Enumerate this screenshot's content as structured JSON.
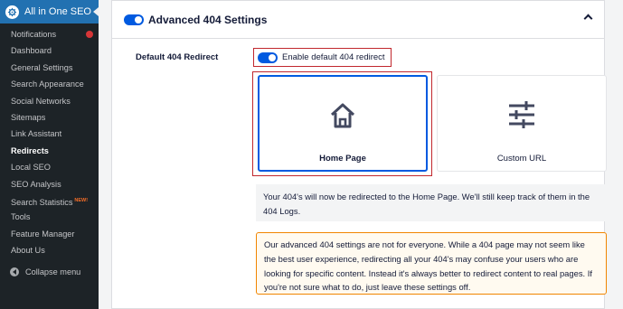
{
  "sidebar": {
    "brand": "All in One SEO",
    "items": [
      {
        "label": "Notifications"
      },
      {
        "label": "Dashboard"
      },
      {
        "label": "General Settings"
      },
      {
        "label": "Search Appearance"
      },
      {
        "label": "Social Networks"
      },
      {
        "label": "Sitemaps"
      },
      {
        "label": "Link Assistant"
      },
      {
        "label": "Redirects"
      },
      {
        "label": "Local SEO"
      },
      {
        "label": "SEO Analysis"
      },
      {
        "label": "Search Statistics",
        "badge": "NEW!"
      },
      {
        "label": "Tools"
      },
      {
        "label": "Feature Manager"
      },
      {
        "label": "About Us"
      }
    ],
    "active_item": "Redirects",
    "collapse_label": "Collapse menu"
  },
  "card": {
    "title": "Advanced 404 Settings",
    "title_toggle_on": true
  },
  "setting": {
    "label": "Default 404 Redirect",
    "enable_label": "Enable default 404 redirect",
    "enable_on": true
  },
  "options": {
    "home": {
      "label": "Home Page",
      "icon": "home-icon",
      "selected": true
    },
    "custom": {
      "label": "Custom URL",
      "icon": "sliders-icon",
      "selected": false
    }
  },
  "info_text": "Your 404's will now be redirected to the Home Page. We'll still keep track of them in the 404 Logs.",
  "warning_text": "Our advanced 404 settings are not for everyone. While a 404 page may not seem like the best user experience, redirecting all your 404's may confuse your users who are looking for specific content. Instead it's always better to redirect content to real pages. If you're not sure what to do, just leave these settings off.",
  "colors": {
    "sidebar_bg": "#1d2327",
    "brand_bg": "#2271b1",
    "accent": "#005ae0",
    "highlight_border": "#c1272d",
    "warning_border": "#f18500"
  }
}
